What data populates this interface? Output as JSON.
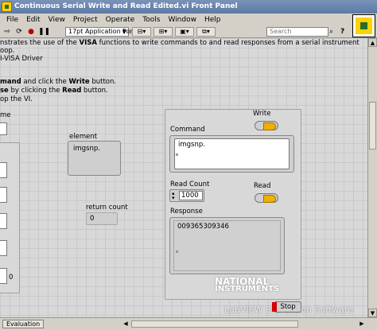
{
  "window": {
    "title": "Continuous Serial Write and Read Edited.vi Front Panel"
  },
  "menu": [
    "File",
    "Edit",
    "View",
    "Project",
    "Operate",
    "Tools",
    "Window",
    "Help"
  ],
  "toolbar": {
    "font": "17pt Application Font",
    "search_placeholder": "Search",
    "help": "?"
  },
  "description": {
    "line1_a": "nstrates the use of the ",
    "line1_b": "VISA",
    "line1_c": " functions to write commands to and read responses from a serial instrument",
    "line2": "oop.",
    "line3": "I-VISA Driver",
    "line4_a": "mand",
    "line4_b": " and click the ",
    "line4_c": "Write",
    "line4_d": " button.",
    "line5_a": "se",
    "line5_b": " by clicking the ",
    "line5_c": "Read",
    "line5_d": " button.",
    "line6": "op the VI."
  },
  "left": {
    "label": "me",
    "count_value": "0"
  },
  "element": {
    "label": "element",
    "value": "imgsnp."
  },
  "return_count": {
    "label": "return count",
    "value": "0"
  },
  "write": {
    "label": "Write"
  },
  "command": {
    "label": "Command",
    "value": "imgsnp."
  },
  "read_count": {
    "label": "Read Count",
    "value": "1000"
  },
  "read": {
    "label": "Read"
  },
  "response": {
    "label": "Response",
    "value": "009365309346"
  },
  "stop": {
    "label": "Stop"
  },
  "watermark": {
    "ni_line1": "NATIONAL",
    "ni_line2": "INSTRUMENTS",
    "labview": "LabVIEW Evaluation Software"
  },
  "status": {
    "mode": "Evaluation"
  },
  "colors": {
    "titlebar": "#5c7aa6",
    "panel": "#d8d8d8",
    "led_on": "#f0b000",
    "stop_red": "#d40000"
  }
}
